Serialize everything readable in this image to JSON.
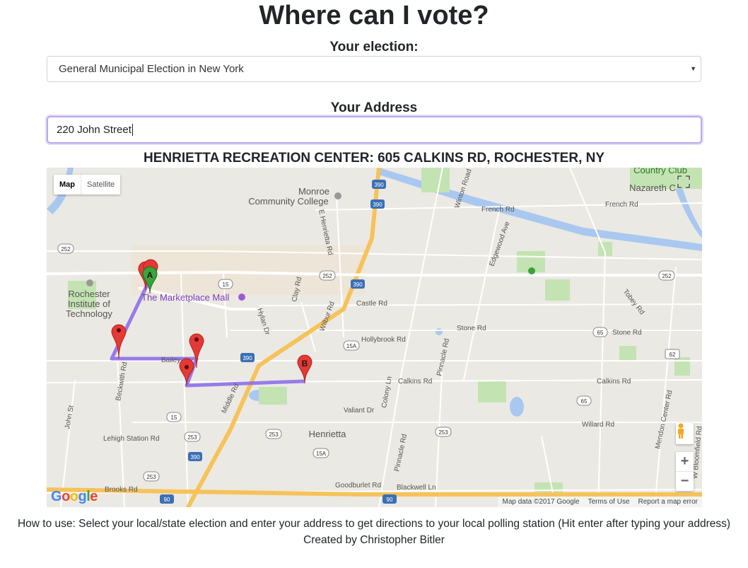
{
  "header": {
    "title": "Where can I vote?"
  },
  "election": {
    "label": "Your election:",
    "selected": "General Municipal Election in New York"
  },
  "address": {
    "label": "Your Address",
    "value": "220 John Street"
  },
  "destination": "HENRIETTA RECREATION CENTER: 605 CALKINS RD, ROCHESTER, NY",
  "map": {
    "type_control": {
      "map": "Map",
      "satellite": "Satellite"
    },
    "markers": {
      "start": "A",
      "end": "B"
    },
    "place_labels": [
      "Monroe",
      "Community College",
      "Rochester",
      "Institute of",
      "Technology",
      "The Marketplace Mall",
      "Henrietta",
      "Country Club",
      "Nazareth C"
    ],
    "road_labels": [
      "French Rd",
      "Castle Rd",
      "Stone Rd",
      "Calkins Rd",
      "Willard Rd",
      "Lehigh Station Rd",
      "Brooks Rd",
      "Goodburlet Rd",
      "Blackwell Ln",
      "Hollybrook Rd",
      "Valiant Dr",
      "Bailey",
      "E Henrietta Rd",
      "Winton Road",
      "Edgewood Ave",
      "Tobey Rd",
      "Clay Rd",
      "Hylan Dr",
      "Middle Rd",
      "Beckwith Rd",
      "Pinnacle Rd",
      "Colony Ln",
      "Mendon Center Rd",
      "W Bloomfield Rd",
      "John St",
      "Wilbur Rd"
    ],
    "shields": [
      "390",
      "390",
      "390",
      "390",
      "390",
      "252",
      "252",
      "252",
      "15",
      "15",
      "15A",
      "15A",
      "65",
      "65",
      "62",
      "253",
      "253",
      "253",
      "90",
      "90"
    ],
    "zoom": {
      "in": "+",
      "out": "−"
    },
    "attribution": {
      "data": "Map data ©2017 Google",
      "terms": "Terms of Use",
      "report": "Report a map error"
    },
    "logo": "Google",
    "colors": {
      "route": "#8e6fe8",
      "marker": "#e53935",
      "start_marker": "#3ba33b",
      "water": "#a8c8f0",
      "park": "#c4e3b2",
      "highway": "#f6c35a"
    }
  },
  "footer": {
    "howto": "How to use: Select your local/state election and enter your address to get directions to your local polling station (Hit enter after typing your address)",
    "credit": "Created by Christopher Bitler"
  }
}
